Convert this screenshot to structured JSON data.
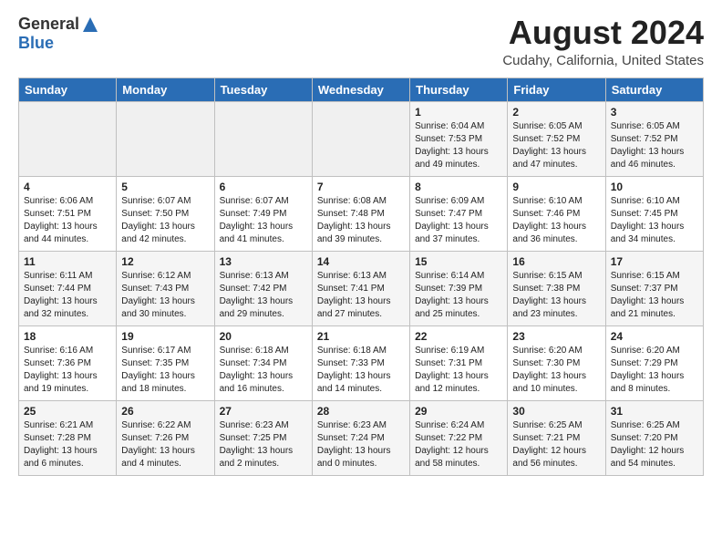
{
  "header": {
    "logo_general": "General",
    "logo_blue": "Blue",
    "title": "August 2024",
    "location": "Cudahy, California, United States"
  },
  "weekdays": [
    "Sunday",
    "Monday",
    "Tuesday",
    "Wednesday",
    "Thursday",
    "Friday",
    "Saturday"
  ],
  "weeks": [
    [
      {
        "day": "",
        "info": ""
      },
      {
        "day": "",
        "info": ""
      },
      {
        "day": "",
        "info": ""
      },
      {
        "day": "",
        "info": ""
      },
      {
        "day": "1",
        "info": "Sunrise: 6:04 AM\nSunset: 7:53 PM\nDaylight: 13 hours\nand 49 minutes."
      },
      {
        "day": "2",
        "info": "Sunrise: 6:05 AM\nSunset: 7:52 PM\nDaylight: 13 hours\nand 47 minutes."
      },
      {
        "day": "3",
        "info": "Sunrise: 6:05 AM\nSunset: 7:52 PM\nDaylight: 13 hours\nand 46 minutes."
      }
    ],
    [
      {
        "day": "4",
        "info": "Sunrise: 6:06 AM\nSunset: 7:51 PM\nDaylight: 13 hours\nand 44 minutes."
      },
      {
        "day": "5",
        "info": "Sunrise: 6:07 AM\nSunset: 7:50 PM\nDaylight: 13 hours\nand 42 minutes."
      },
      {
        "day": "6",
        "info": "Sunrise: 6:07 AM\nSunset: 7:49 PM\nDaylight: 13 hours\nand 41 minutes."
      },
      {
        "day": "7",
        "info": "Sunrise: 6:08 AM\nSunset: 7:48 PM\nDaylight: 13 hours\nand 39 minutes."
      },
      {
        "day": "8",
        "info": "Sunrise: 6:09 AM\nSunset: 7:47 PM\nDaylight: 13 hours\nand 37 minutes."
      },
      {
        "day": "9",
        "info": "Sunrise: 6:10 AM\nSunset: 7:46 PM\nDaylight: 13 hours\nand 36 minutes."
      },
      {
        "day": "10",
        "info": "Sunrise: 6:10 AM\nSunset: 7:45 PM\nDaylight: 13 hours\nand 34 minutes."
      }
    ],
    [
      {
        "day": "11",
        "info": "Sunrise: 6:11 AM\nSunset: 7:44 PM\nDaylight: 13 hours\nand 32 minutes."
      },
      {
        "day": "12",
        "info": "Sunrise: 6:12 AM\nSunset: 7:43 PM\nDaylight: 13 hours\nand 30 minutes."
      },
      {
        "day": "13",
        "info": "Sunrise: 6:13 AM\nSunset: 7:42 PM\nDaylight: 13 hours\nand 29 minutes."
      },
      {
        "day": "14",
        "info": "Sunrise: 6:13 AM\nSunset: 7:41 PM\nDaylight: 13 hours\nand 27 minutes."
      },
      {
        "day": "15",
        "info": "Sunrise: 6:14 AM\nSunset: 7:39 PM\nDaylight: 13 hours\nand 25 minutes."
      },
      {
        "day": "16",
        "info": "Sunrise: 6:15 AM\nSunset: 7:38 PM\nDaylight: 13 hours\nand 23 minutes."
      },
      {
        "day": "17",
        "info": "Sunrise: 6:15 AM\nSunset: 7:37 PM\nDaylight: 13 hours\nand 21 minutes."
      }
    ],
    [
      {
        "day": "18",
        "info": "Sunrise: 6:16 AM\nSunset: 7:36 PM\nDaylight: 13 hours\nand 19 minutes."
      },
      {
        "day": "19",
        "info": "Sunrise: 6:17 AM\nSunset: 7:35 PM\nDaylight: 13 hours\nand 18 minutes."
      },
      {
        "day": "20",
        "info": "Sunrise: 6:18 AM\nSunset: 7:34 PM\nDaylight: 13 hours\nand 16 minutes."
      },
      {
        "day": "21",
        "info": "Sunrise: 6:18 AM\nSunset: 7:33 PM\nDaylight: 13 hours\nand 14 minutes."
      },
      {
        "day": "22",
        "info": "Sunrise: 6:19 AM\nSunset: 7:31 PM\nDaylight: 13 hours\nand 12 minutes."
      },
      {
        "day": "23",
        "info": "Sunrise: 6:20 AM\nSunset: 7:30 PM\nDaylight: 13 hours\nand 10 minutes."
      },
      {
        "day": "24",
        "info": "Sunrise: 6:20 AM\nSunset: 7:29 PM\nDaylight: 13 hours\nand 8 minutes."
      }
    ],
    [
      {
        "day": "25",
        "info": "Sunrise: 6:21 AM\nSunset: 7:28 PM\nDaylight: 13 hours\nand 6 minutes."
      },
      {
        "day": "26",
        "info": "Sunrise: 6:22 AM\nSunset: 7:26 PM\nDaylight: 13 hours\nand 4 minutes."
      },
      {
        "day": "27",
        "info": "Sunrise: 6:23 AM\nSunset: 7:25 PM\nDaylight: 13 hours\nand 2 minutes."
      },
      {
        "day": "28",
        "info": "Sunrise: 6:23 AM\nSunset: 7:24 PM\nDaylight: 13 hours\nand 0 minutes."
      },
      {
        "day": "29",
        "info": "Sunrise: 6:24 AM\nSunset: 7:22 PM\nDaylight: 12 hours\nand 58 minutes."
      },
      {
        "day": "30",
        "info": "Sunrise: 6:25 AM\nSunset: 7:21 PM\nDaylight: 12 hours\nand 56 minutes."
      },
      {
        "day": "31",
        "info": "Sunrise: 6:25 AM\nSunset: 7:20 PM\nDaylight: 12 hours\nand 54 minutes."
      }
    ]
  ]
}
